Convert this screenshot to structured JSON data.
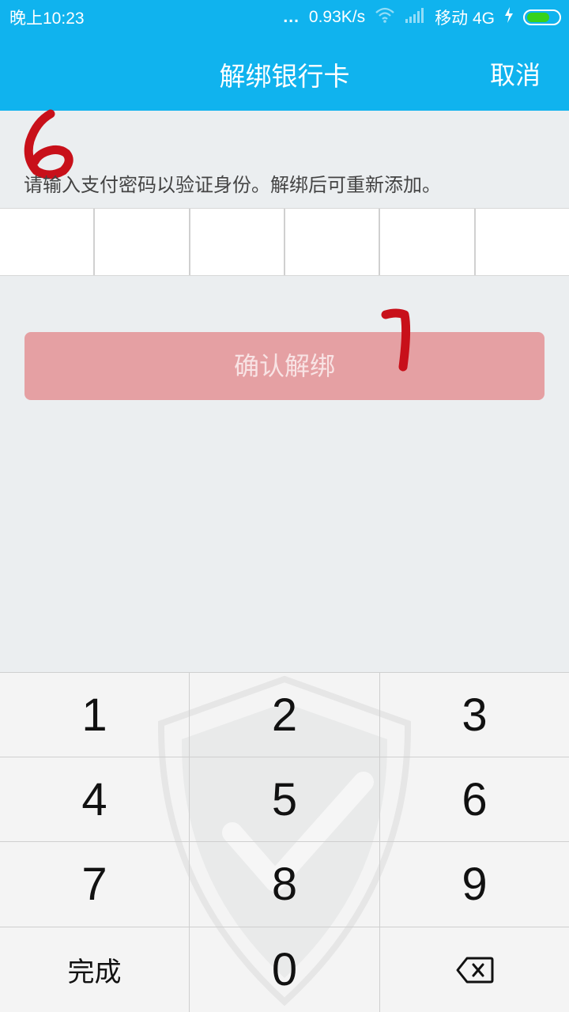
{
  "status_bar": {
    "time": "晚上10:23",
    "dots": "...",
    "speed": "0.93K/s",
    "carrier": "移动 4G",
    "icons": [
      "wifi-icon",
      "signal-icon",
      "charging-bolt-icon",
      "battery-icon"
    ]
  },
  "header": {
    "title": "解绑银行卡",
    "cancel_label": "取消"
  },
  "hint": "请输入支付密码以验证身份。解绑后可重新添加。",
  "password_box_count": 6,
  "confirm_button": "确认解绑",
  "keypad": {
    "keys": [
      "1",
      "2",
      "3",
      "4",
      "5",
      "6",
      "7",
      "8",
      "9",
      "完成",
      "0"
    ],
    "backspace_icon": "backspace-icon",
    "watermark_icon": "shield-check-icon"
  },
  "colors": {
    "header_bg": "#10B3EE",
    "page_bg": "#EBEEF0",
    "confirm_disabled_bg": "#E5A0A3",
    "annotation": "#C8101A",
    "battery_fill": "#36D21C"
  }
}
